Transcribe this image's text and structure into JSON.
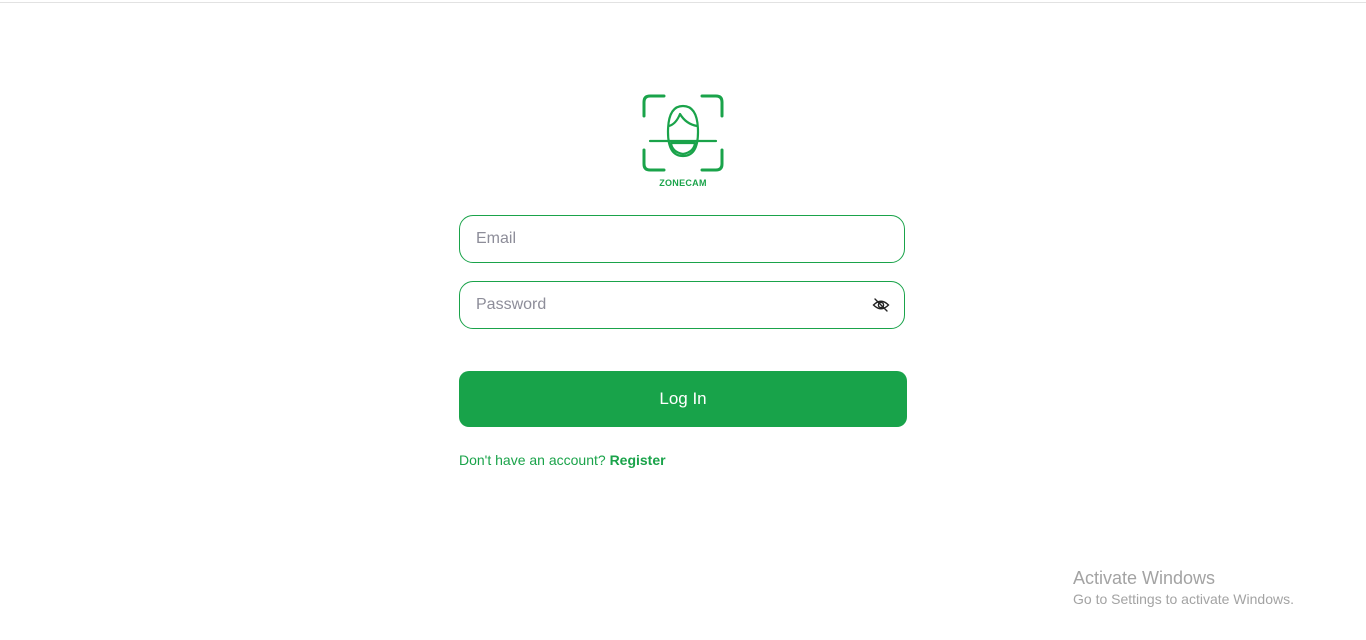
{
  "brand": {
    "name": "ZONECAM",
    "accent_color": "#1aa34a",
    "logo_icon": "face-scan-icon"
  },
  "form": {
    "email_placeholder": "Email",
    "email_value": "",
    "password_placeholder": "Password",
    "password_value": "",
    "password_toggle_icon": "eye-off-icon",
    "login_label": "Log In",
    "register_prompt": "Don't have an account?",
    "register_link": "Register"
  },
  "watermark": {
    "title": "Activate Windows",
    "subtitle": "Go to Settings to activate Windows."
  }
}
